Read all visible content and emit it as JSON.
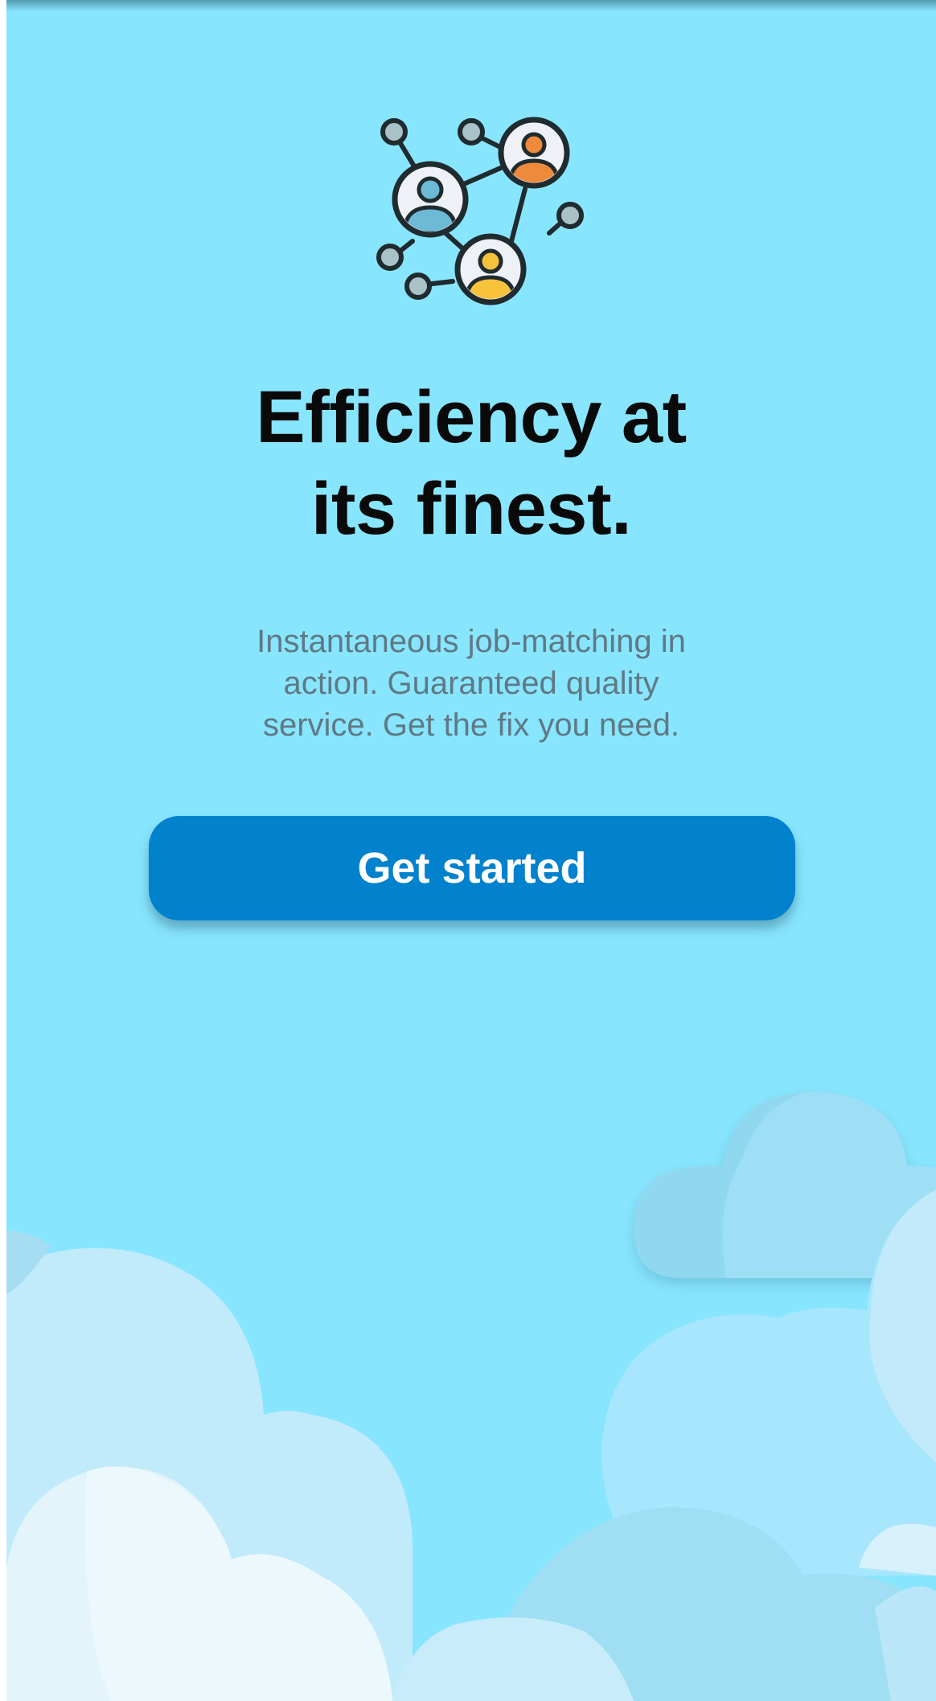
{
  "onboarding": {
    "headline_line1": "Efficiency at",
    "headline_line2": "its finest.",
    "subtitle_line1": "Instantaneous job-matching in",
    "subtitle_line2": "action. Guaranteed quality",
    "subtitle_line3": "service. Get the fix you need.",
    "cta_label": "Get started",
    "illustration_icon": "network-people-icon"
  },
  "colors": {
    "background": "#88e5fe",
    "cta": "#0282cc",
    "headline": "#0a0a0a",
    "subtitle": "#5f7984"
  }
}
